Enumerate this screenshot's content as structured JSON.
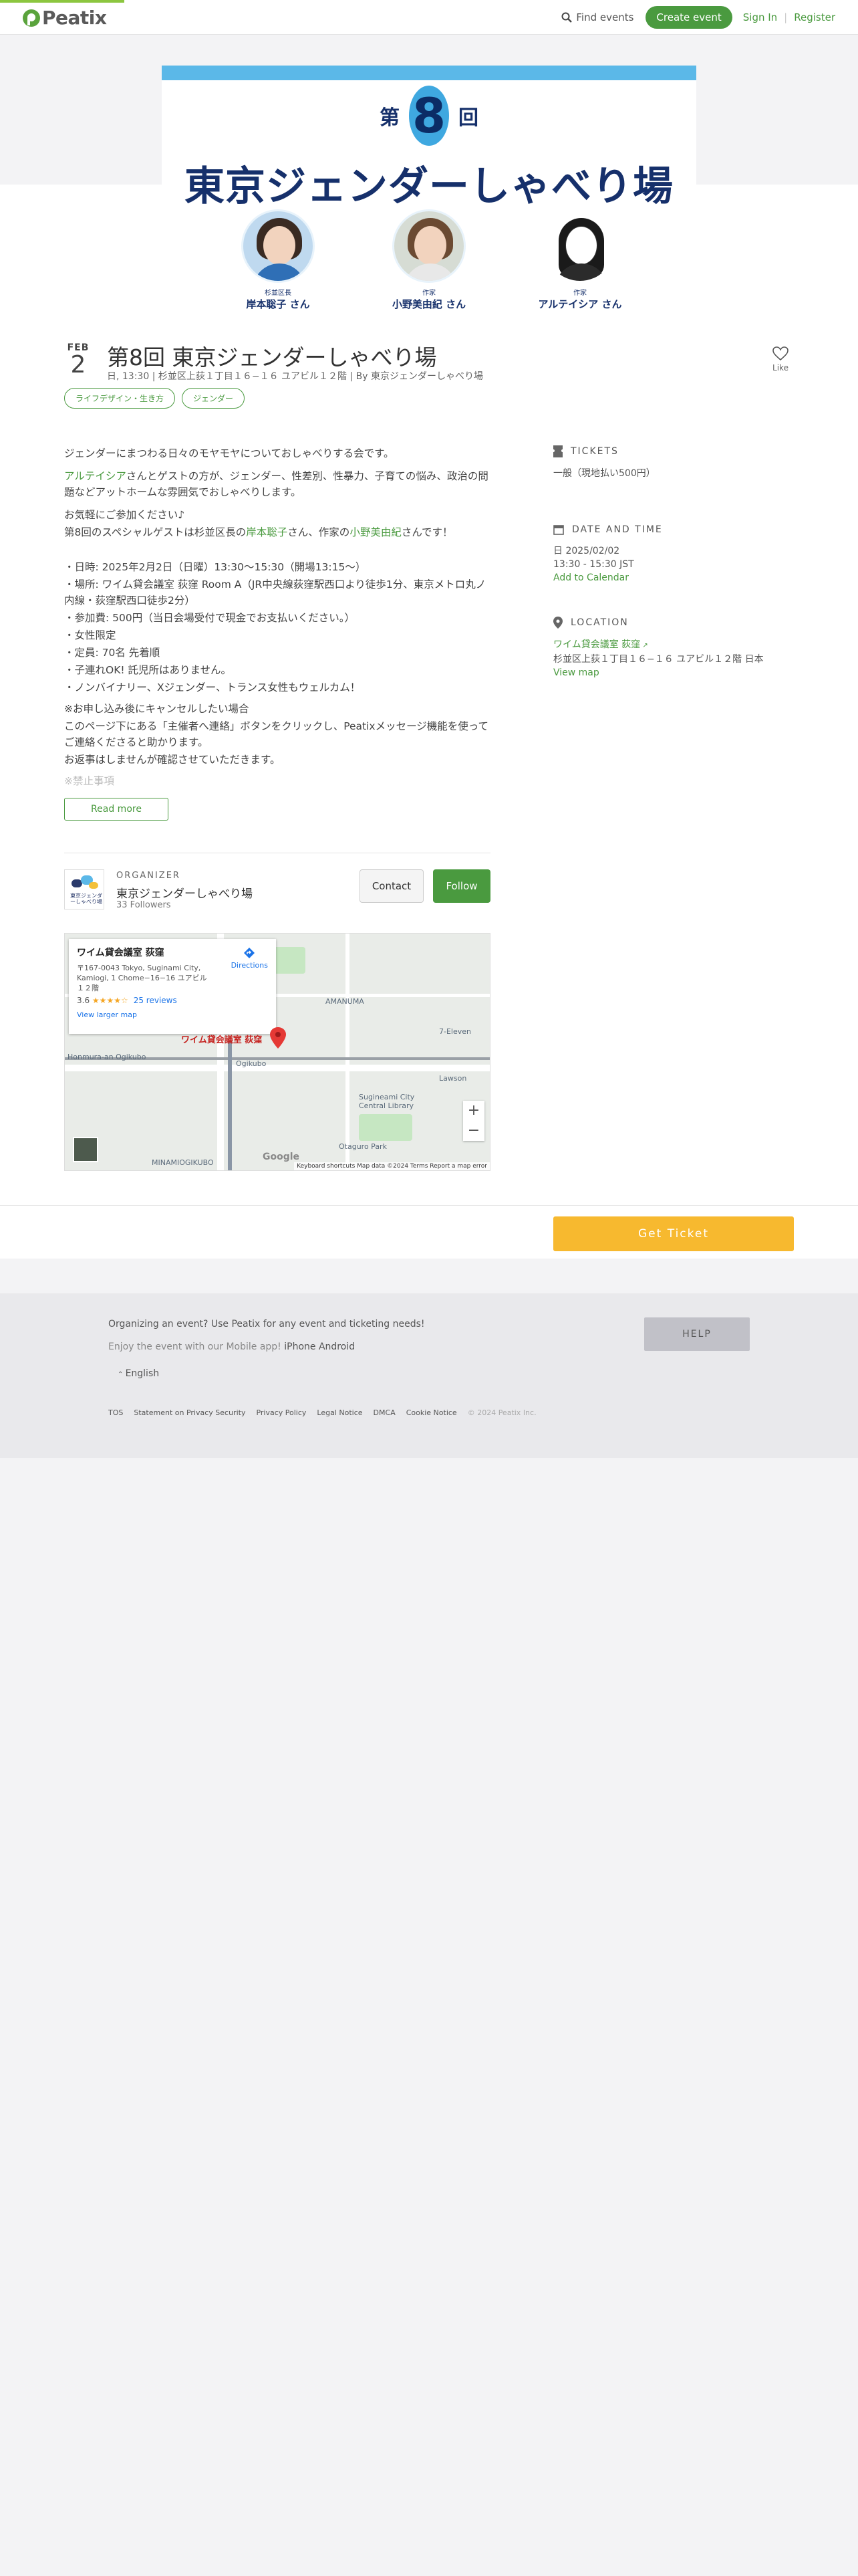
{
  "header": {
    "logo_text": "Peatix",
    "find_events": "Find events",
    "create_event": "Create event",
    "sign_in": "Sign In",
    "register": "Register",
    "separator": "|"
  },
  "banner": {
    "edition_prefix": "第",
    "edition_number": "8",
    "edition_suffix": "回",
    "title": "東京ジェンダーしゃべり場",
    "guests": [
      {
        "role": "杉並区長",
        "name": "岸本聡子 さん"
      },
      {
        "role": "作家",
        "name": "小野美由紀 さん"
      },
      {
        "role": "作家",
        "name": "アルテイシア さん"
      }
    ]
  },
  "event": {
    "month": "FEB",
    "day": "2",
    "title": "第8回 東京ジェンダーしゃべり場",
    "meta": "日, 13:30 | 杉並区上荻１丁目１６−１６ ユアビル１２階 | By 東京ジェンダーしゃべり場",
    "like_label": "Like",
    "tags": [
      "ライフデザイン・生き方",
      "ジェンダー"
    ]
  },
  "description": {
    "line1": "ジェンダーにまつわる日々のモヤモヤについておしゃべりする会です。",
    "line2_link": "アルテイシア",
    "line2_rest": "さんとゲストの方が、ジェンダー、性差別、性暴力、子育ての悩み、政治の問題などアットホームな雰囲気でおしゃべりします。",
    "line3": "お気軽にご参加ください♪",
    "line4_a": "第8回のスペシャルゲストは杉並区長の",
    "line4_link1": "岸本聡子",
    "line4_b": "さん、作家の",
    "line4_link2": "小野美由紀",
    "line4_c": "さんです！",
    "details": [
      "・日時: 2025年2月2日（日曜）13:30〜15:30（開場13:15〜）",
      "・場所: ワイム貸会議室 荻窪 Room A（JR中央線荻窪駅西口より徒歩1分、東京メトロ丸ノ内線・荻窪駅西口徒歩2分）",
      "・参加費: 500円（当日会場受付で現金でお支払いください。）",
      "・女性限定",
      "・定員: 70名 先着順",
      "・子連れOK! 託児所はありません。",
      "・ノンバイナリー、Xジェンダー、トランス女性もウェルカム！"
    ],
    "cancel": [
      "※お申し込み後にキャンセルしたい場合",
      "このページ下にある「主催者へ連絡」ボタンをクリックし、Peatixメッセージ機能を使ってご連絡くださると助かります。",
      "お返事はしませんが確認させていただきます。"
    ],
    "faded": "※禁止事項",
    "read_more": "Read more"
  },
  "organizer": {
    "label": "ORGANIZER",
    "name": "東京ジェンダーしゃべり場",
    "followers": "33 Followers",
    "contact": "Contact",
    "follow": "Follow",
    "logo_text": "東京ジェンダーしゃべり場"
  },
  "map": {
    "place_name": "ワイム貸会議室 荻窪",
    "address": "〒167-0043 Tokyo, Suginami City, Kamiogi, 1 Chome−16−16 ユアビル １２階",
    "rating": "3.6",
    "stars": "★★★★☆",
    "reviews": "25 reviews",
    "view_larger": "View larger map",
    "directions": "Directions",
    "pin_label": "ワイム貸会議室 荻窪",
    "labels": [
      "AMANUMA",
      "Ogikubo",
      "Sugineami City Central Library",
      "Otaguro Park",
      "7-Eleven",
      "Lawson",
      "MINAMIOGIKUBO",
      "Honmura-an Ogikubo"
    ],
    "footer": "Keyboard shortcuts   Map data ©2024   Terms   Report a map error",
    "google": "Google",
    "zoom_in": "+",
    "zoom_out": "−"
  },
  "sidebar": {
    "tickets_head": "TICKETS",
    "tickets_body": "一般（現地払い500円）",
    "datetime_head": "DATE AND TIME",
    "date": "日 2025/02/02",
    "time": "13:30 - 15:30 JST",
    "add_calendar": "Add to Calendar",
    "location_head": "LOCATION",
    "venue": "ワイム貸会議室 荻窪",
    "venue_address": "杉並区上荻１丁目１６−１６ ユアビル１２階 日本",
    "view_map": "View map"
  },
  "ticket_bar": {
    "get_ticket": "Get Ticket"
  },
  "footer": {
    "organizing": "Organizing an event? Use Peatix for any event and ticketing needs!",
    "mobile": "Enjoy the event with our Mobile app!",
    "iphone": "iPhone",
    "android": "Android",
    "language": "English",
    "help": "HELP",
    "links": [
      "TOS",
      "Statement on Privacy Security",
      "Privacy Policy",
      "Legal Notice",
      "DMCA",
      "Cookie Notice"
    ],
    "copyright": "© 2024 Peatix Inc."
  },
  "colors": {
    "brand_green": "#4a9a3f",
    "ticket_yellow": "#f7b92f",
    "banner_blue": "#5bb8e8",
    "banner_navy": "#16306b"
  }
}
